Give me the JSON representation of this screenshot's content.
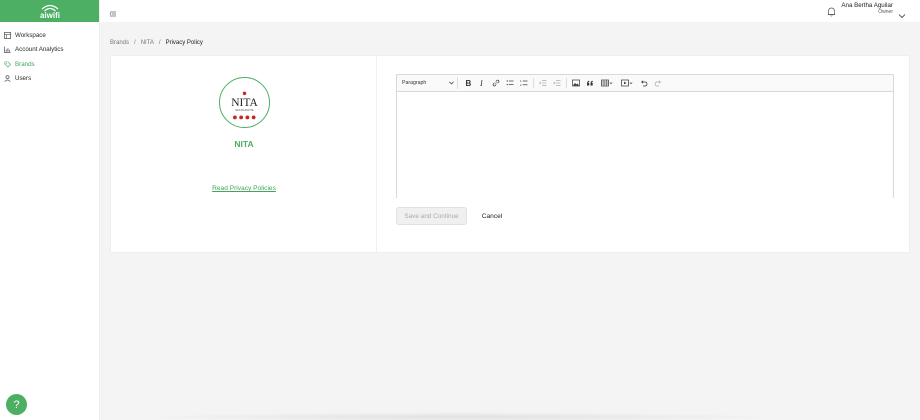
{
  "app": {
    "logo_text": "aiwifi",
    "accent_color": "#4caf63"
  },
  "sidebar": {
    "items": [
      {
        "label": "Workspace",
        "icon": "grid-icon"
      },
      {
        "label": "Account Analytics",
        "icon": "bar-chart-icon"
      },
      {
        "label": "Brands",
        "icon": "tags-icon",
        "active": true
      },
      {
        "label": "Users",
        "icon": "user-icon"
      }
    ],
    "help_label": "?"
  },
  "header": {
    "user_name": "Ana Bertha Aguilar",
    "user_role": "Owner"
  },
  "breadcrumb": {
    "items": [
      "Brands",
      "NITA",
      "Privacy Policy"
    ],
    "separator": "/"
  },
  "brand": {
    "logo_text": "NITA",
    "logo_subtext": "RESTAURANTE",
    "name": "NITA",
    "privacy_link": "Read Privacy Policies"
  },
  "editor": {
    "block_style": "Paragraph",
    "content": ""
  },
  "actions": {
    "save_label": "Save and Continue",
    "cancel_label": "Cancel"
  }
}
